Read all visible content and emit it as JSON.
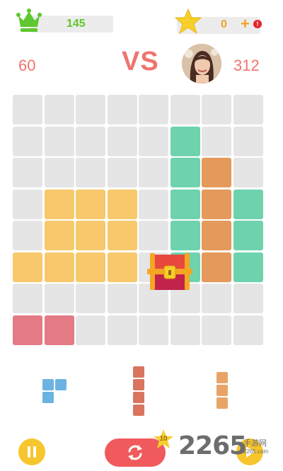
{
  "header": {
    "crown_icon": "crown-icon",
    "crown_count": "145",
    "star_icon": "star-icon",
    "star_count": "0",
    "plus_label": "+",
    "alert_label": "!"
  },
  "versus": {
    "player_score": "60",
    "vs_label": "VS",
    "opponent_score": "312"
  },
  "colors": {
    "empty": "#e5e5e5",
    "yellow": "#f7c96c",
    "green": "#6ed3ad",
    "orange": "#e39a5b",
    "pink": "#e47a84",
    "blue": "#6bb3e0",
    "brick": "#d9745e",
    "tan": "#e8a466"
  },
  "board": {
    "rows": 8,
    "cols": 8,
    "filled": [
      {
        "r": 1,
        "c": 5,
        "color": "green"
      },
      {
        "r": 2,
        "c": 5,
        "color": "green"
      },
      {
        "r": 2,
        "c": 6,
        "color": "orange"
      },
      {
        "r": 3,
        "c": 1,
        "color": "yellow"
      },
      {
        "r": 3,
        "c": 2,
        "color": "yellow"
      },
      {
        "r": 3,
        "c": 3,
        "color": "yellow"
      },
      {
        "r": 3,
        "c": 5,
        "color": "green"
      },
      {
        "r": 3,
        "c": 6,
        "color": "orange"
      },
      {
        "r": 3,
        "c": 7,
        "color": "green"
      },
      {
        "r": 4,
        "c": 1,
        "color": "yellow"
      },
      {
        "r": 4,
        "c": 2,
        "color": "yellow"
      },
      {
        "r": 4,
        "c": 3,
        "color": "yellow"
      },
      {
        "r": 4,
        "c": 5,
        "color": "green"
      },
      {
        "r": 4,
        "c": 6,
        "color": "orange"
      },
      {
        "r": 4,
        "c": 7,
        "color": "green"
      },
      {
        "r": 5,
        "c": 0,
        "color": "yellow"
      },
      {
        "r": 5,
        "c": 1,
        "color": "yellow"
      },
      {
        "r": 5,
        "c": 2,
        "color": "yellow"
      },
      {
        "r": 5,
        "c": 3,
        "color": "yellow"
      },
      {
        "r": 5,
        "c": 5,
        "color": "green"
      },
      {
        "r": 5,
        "c": 6,
        "color": "orange"
      },
      {
        "r": 5,
        "c": 7,
        "color": "green"
      },
      {
        "r": 7,
        "c": 0,
        "color": "pink"
      },
      {
        "r": 7,
        "c": 1,
        "color": "pink"
      }
    ],
    "chest_icon": "treasure-chest-icon"
  },
  "tray": {
    "pieces": [
      {
        "name": "tray-piece-1",
        "color": "blue",
        "cells": [
          [
            0,
            0
          ],
          [
            0,
            1
          ],
          [
            1,
            0
          ]
        ]
      },
      {
        "name": "tray-piece-2",
        "color": "brick",
        "cells": [
          [
            0,
            0
          ],
          [
            1,
            0
          ],
          [
            2,
            0
          ],
          [
            3,
            0
          ]
        ]
      },
      {
        "name": "tray-piece-3",
        "color": "tan",
        "cells": [
          [
            0,
            0
          ],
          [
            1,
            0
          ],
          [
            2,
            0
          ]
        ]
      }
    ]
  },
  "footer": {
    "pause_icon": "pause-icon",
    "refresh_icon": "refresh-icon",
    "refresh_badge": "10",
    "next_icon": "next-icon",
    "watermark_number": "2265",
    "watermark_cn": "手游网",
    "watermark_url": "2265.com"
  }
}
